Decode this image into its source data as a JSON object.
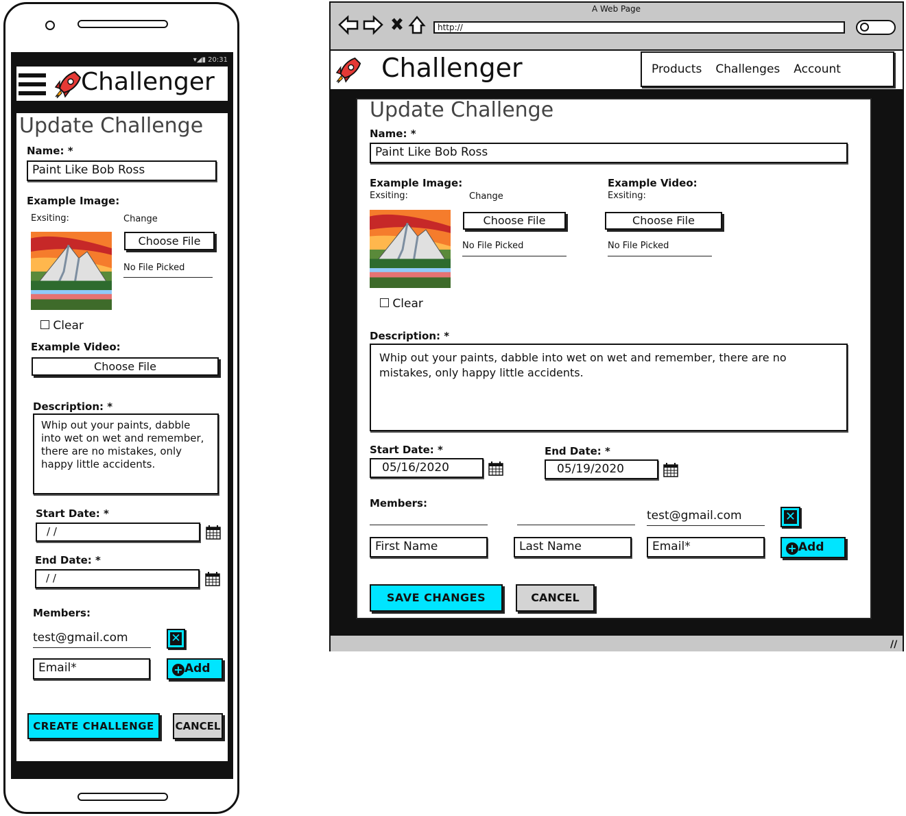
{
  "brand": {
    "name": "Challenger"
  },
  "mobile": {
    "status_time": "20:31",
    "page_title": "Update Challenge",
    "name_label": "Name: *",
    "name_value": "Paint Like Bob Ross",
    "image_label": "Example Image:",
    "existing_label": "Exsiting:",
    "change_label": "Change",
    "choose_file": "Choose File",
    "no_file": "No File Picked",
    "clear_label": "Clear",
    "video_label": "Example Video:",
    "video_choose_file": "Choose File",
    "description_label": "Description: *",
    "description_value": "Whip out your paints, dabble into wet on wet and remember, there are no mistakes, only happy little accidents.",
    "start_label": "Start Date: *",
    "start_value": " /  /",
    "end_label": "End Date: *",
    "end_value": " /  /",
    "members_label": "Members:",
    "member_email": "test@gmail.com",
    "email_placeholder": "Email*",
    "add_label": "Add",
    "primary_button": "CREATE CHALLENGE",
    "cancel_button": "CANCEL"
  },
  "browser": {
    "window_title": "A Web Page",
    "url": "http://",
    "nav": [
      "Products",
      "Challenges",
      "Account"
    ],
    "page_title": "Update Challenge",
    "name_label": "Name: *",
    "name_value": "Paint Like Bob Ross",
    "image_label": "Example Image:",
    "image_existing": "Exsiting:",
    "image_change": "Change",
    "image_choose": "Choose File",
    "image_no_file": "No File Picked",
    "clear_label": "Clear",
    "video_label": "Example Video:",
    "video_existing": "Exsiting:",
    "video_choose": "Choose File",
    "video_no_file": "No File Picked",
    "description_label": "Description: *",
    "description_value": "Whip out your paints, dabble into wet on wet and remember, there are no mistakes, only happy little accidents.",
    "start_label": "Start Date: *",
    "start_value": "05/16/2020",
    "end_label": "End Date: *",
    "end_value": "05/19/2020",
    "members_label": "Members:",
    "member_email": "test@gmail.com",
    "first_name_placeholder": "First Name",
    "last_name_placeholder": "Last Name",
    "email_placeholder": "Email*",
    "add_label": "Add",
    "save_button": "SAVE CHANGES",
    "cancel_button": "CANCEL"
  },
  "colors": {
    "accent": "#00e5ff",
    "cancel": "#d4d4d4",
    "frame": "#111111"
  }
}
